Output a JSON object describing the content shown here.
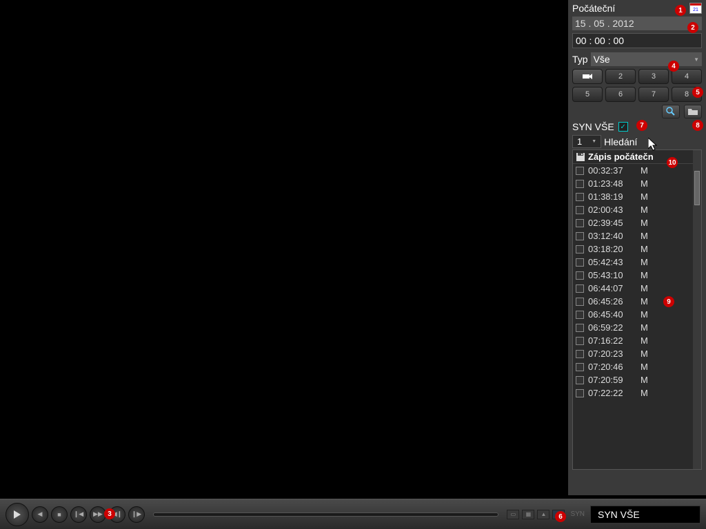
{
  "sidebar": {
    "start_label": "Počáteční",
    "date": "15 . 05 . 2012",
    "time": "00 : 00 : 00",
    "type_label": "Typ",
    "type_value": "Vše",
    "channels": [
      "cam",
      "2",
      "3",
      "4",
      "5",
      "6",
      "7",
      "8"
    ],
    "syn_all": "SYN VŠE",
    "syn_checked": true,
    "num_value": "1",
    "search_label": "Hledání"
  },
  "list": {
    "header": "Zápis počátečn",
    "items": [
      {
        "time": "00:32:37",
        "type": "M"
      },
      {
        "time": "01:23:48",
        "type": "M"
      },
      {
        "time": "01:38:19",
        "type": "M"
      },
      {
        "time": "02:00:43",
        "type": "M"
      },
      {
        "time": "02:39:45",
        "type": "M"
      },
      {
        "time": "03:12:40",
        "type": "M"
      },
      {
        "time": "03:18:20",
        "type": "M"
      },
      {
        "time": "05:42:43",
        "type": "M"
      },
      {
        "time": "05:43:10",
        "type": "M"
      },
      {
        "time": "06:44:07",
        "type": "M"
      },
      {
        "time": "06:45:26",
        "type": "M"
      },
      {
        "time": "06:45:40",
        "type": "M"
      },
      {
        "time": "06:59:22",
        "type": "M"
      },
      {
        "time": "07:16:22",
        "type": "M"
      },
      {
        "time": "07:20:23",
        "type": "M"
      },
      {
        "time": "07:20:46",
        "type": "M"
      },
      {
        "time": "07:20:59",
        "type": "M"
      },
      {
        "time": "07:22:22",
        "type": "M"
      }
    ]
  },
  "bottom": {
    "syn_small": "SYN",
    "syn_display": "SYN VŠE"
  },
  "markers": {
    "m1": "1",
    "m2": "2",
    "m3": "3",
    "m4": "4",
    "m5": "5",
    "m6": "6",
    "m7": "7",
    "m8": "8",
    "m9": "9",
    "m10": "10"
  },
  "cal_text": "21"
}
